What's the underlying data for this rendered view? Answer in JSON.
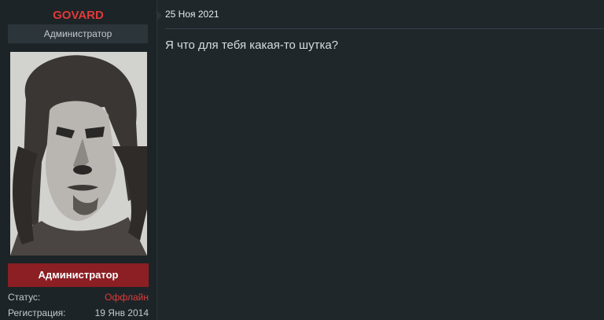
{
  "user": {
    "name": "GOVARD",
    "title": "Администратор",
    "group": "Администратор"
  },
  "stats": [
    {
      "label": "Статус:",
      "value": "Оффлайн"
    },
    {
      "label": "Регистрация:",
      "value": "19 Янв 2014"
    }
  ],
  "post": {
    "date": "25 Ноя 2021",
    "text": "Я что для тебя какая-то шутка?"
  },
  "colors": {
    "background": "#20272b",
    "username": "#e03a3a",
    "group_banner": "#8b1f24",
    "offline": "#e03a3a"
  }
}
